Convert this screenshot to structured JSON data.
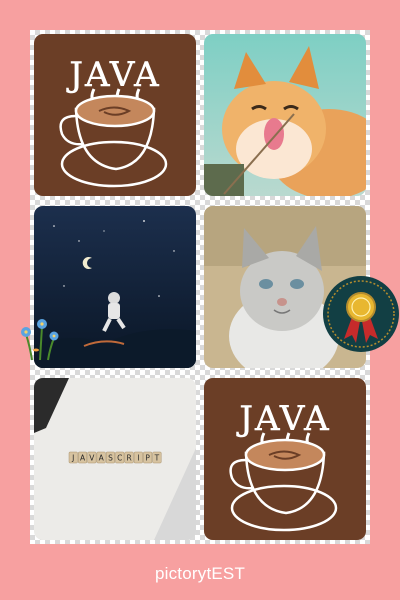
{
  "colors": {
    "background": "#f7a0a0",
    "coffee_bg": "#6b3e26",
    "caption": "#ffffff"
  },
  "tiles": [
    {
      "name": "coffee-java-image",
      "icon": "java-coffee-cup"
    },
    {
      "name": "orange-cat-image",
      "icon": "cat-licking"
    },
    {
      "name": "astronaut-night-image",
      "icon": "astronaut"
    },
    {
      "name": "gray-cat-image",
      "icon": "cat-face"
    },
    {
      "name": "javascript-tiles-image",
      "icon": "letter-tiles"
    },
    {
      "name": "coffee-java-image-2",
      "icon": "java-coffee-cup"
    }
  ],
  "coffee_logo_text": "JAVA",
  "javascript_tiles": [
    "J",
    "A",
    "V",
    "A",
    "S",
    "C",
    "R",
    "I",
    "P",
    "T"
  ],
  "stickers": {
    "flowers": "flowers-sticker",
    "medal": "medal-sticker"
  },
  "caption": "pictorytEST"
}
